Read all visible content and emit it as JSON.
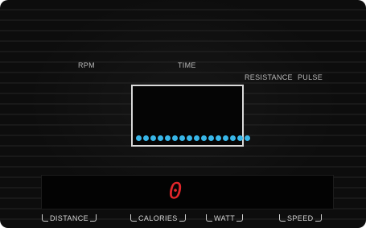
{
  "labels": {
    "rpm": "RPM",
    "time": "TIME",
    "resistance": "RESISTANCE",
    "pulse": "PULSE"
  },
  "display": {
    "segment_value": "0",
    "segment_color": "#e2262b",
    "dot_count": 16,
    "dot_color": "#38b6e8"
  },
  "modes": {
    "distance": "DISTANCE",
    "calories": "CALORIES",
    "watt": "WATT",
    "speed": "SPEED"
  }
}
